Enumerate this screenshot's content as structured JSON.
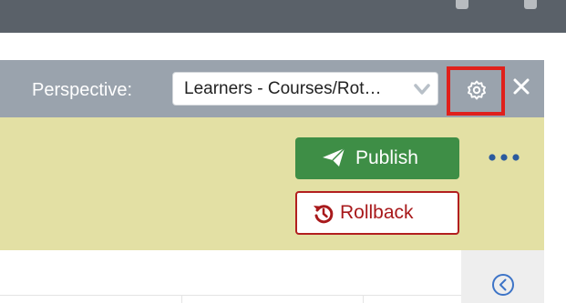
{
  "toolbar": {
    "perspective_label": "Perspective:",
    "perspective_value": "Learners - Courses/Rot…",
    "settings_icon": "gear-icon",
    "close_icon": "close-icon"
  },
  "actions": {
    "publish_label": "Publish",
    "publish_icon": "paper-plane-icon",
    "rollback_label": "Rollback",
    "rollback_icon": "history-icon",
    "more_icon": "ellipsis-icon"
  },
  "panel": {
    "collapse_icon": "chevron-left-circle-icon"
  },
  "colors": {
    "topbar": "#5a6169",
    "toolbar": "#9aa3ad",
    "actionbar": "#e3e0a4",
    "publish": "#3e8e46",
    "rollback_border": "#b21f1f",
    "highlight": "#e0201b",
    "more_icon": "#2b5a9e"
  }
}
